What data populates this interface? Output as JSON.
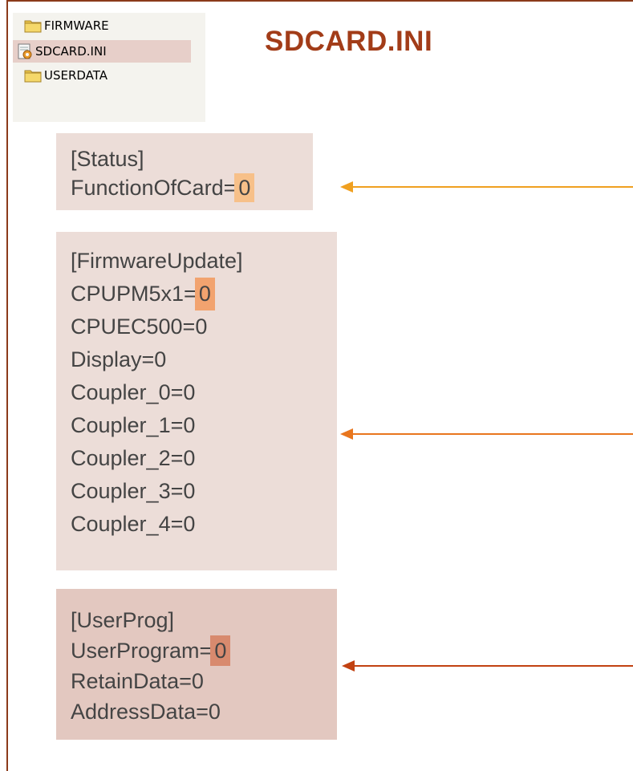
{
  "explorer": {
    "items": [
      {
        "label": "FIRMWARE",
        "icon": "folder-icon",
        "selected": false
      },
      {
        "label": "SDCARD.INI",
        "icon": "ini-file-icon",
        "selected": true
      },
      {
        "label": "USERDATA",
        "icon": "folder-icon",
        "selected": false
      }
    ]
  },
  "title": "SDCARD.INI",
  "sections": {
    "status": {
      "header": "[Status]",
      "line1_key": "FunctionOfCard=",
      "line1_val": "0",
      "highlight_color": "#f7c089"
    },
    "firmware": {
      "header": "[FirmwareUpdate]",
      "line1_key": "CPUPM5x1=",
      "line1_val": "0",
      "lines": [
        "CPUEC500=0",
        "Display=0",
        "Coupler_0=0",
        "Coupler_1=0",
        "Coupler_2=0",
        "Coupler_3=0",
        "Coupler_4=0"
      ],
      "highlight_color": "#f2a36f"
    },
    "userprog": {
      "header": "[UserProg]",
      "line1_key": "UserProgram=",
      "line1_val": "0",
      "lines": [
        "RetainData=0",
        "AddressData=0"
      ],
      "highlight_color": "#d88a6e"
    }
  },
  "colors": {
    "accent": "#a23c18",
    "arrow_status": "#f0a020",
    "arrow_firmware": "#e8761e",
    "arrow_userprog": "#c24212"
  }
}
